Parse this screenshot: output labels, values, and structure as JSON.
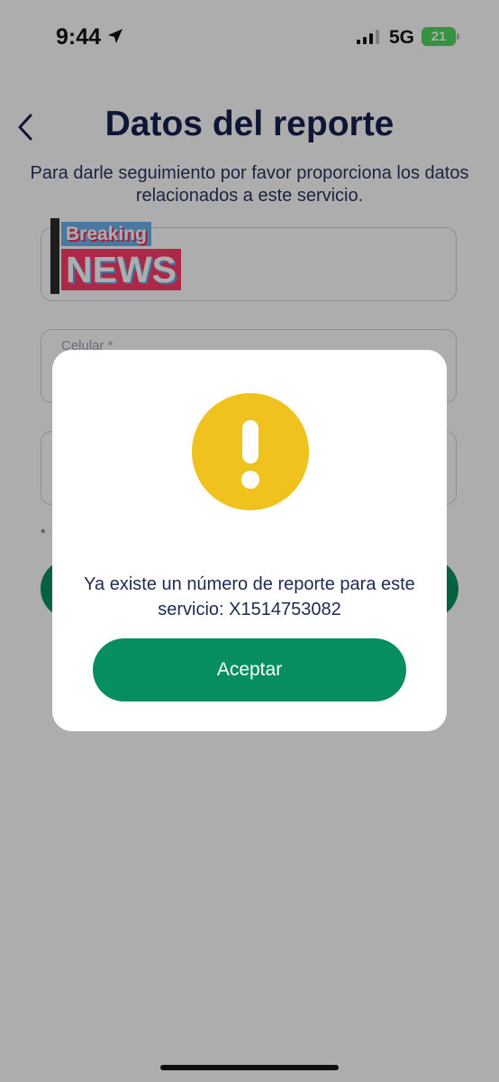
{
  "status_bar": {
    "time": "9:44",
    "network": "5G",
    "battery": "21",
    "icons": [
      "location-arrow-icon",
      "signal-icon",
      "battery-icon"
    ]
  },
  "header": {
    "title": "Datos del reporte",
    "subtitle": "Para darle seguimiento por favor proporciona los datos relacionados a este servicio.",
    "back_icon": "chevron-left-icon"
  },
  "form": {
    "fields": [
      {
        "label": ""
      },
      {
        "label": "Celular *"
      },
      {
        "label": ""
      }
    ],
    "note": "* "
  },
  "sticker": {
    "top": "Breaking",
    "bottom": "NEWS"
  },
  "modal": {
    "icon": "exclamation-circle-icon",
    "message": "Ya existe un número de reporte para este servicio: X1514753082",
    "button": "Aceptar"
  },
  "colors": {
    "accent_green": "#068e60",
    "warning_yellow": "#f0c21e",
    "title_navy": "#16204e"
  }
}
